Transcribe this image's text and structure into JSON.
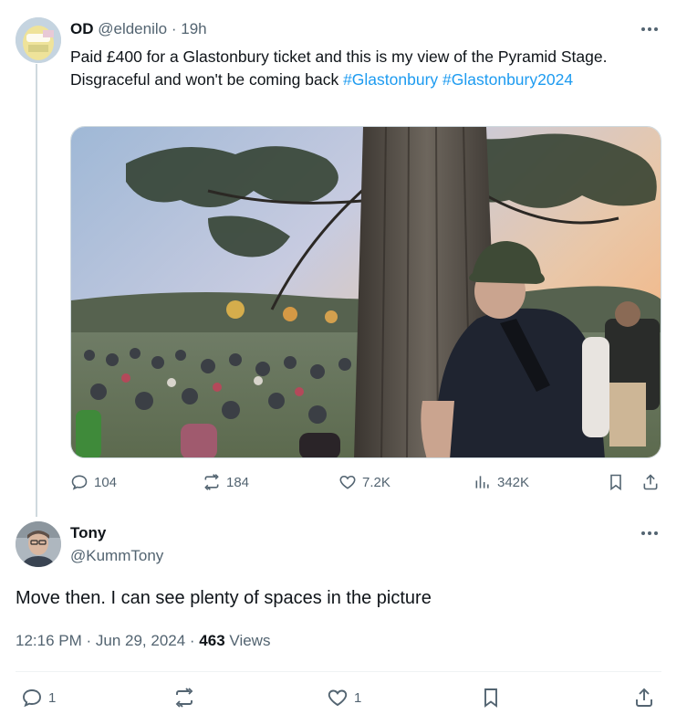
{
  "tweet1": {
    "author_name": "OD",
    "handle": "@eldenilo",
    "separator": "·",
    "time_ago": "19h",
    "text": "Paid £400 for a Glastonbury ticket and this is my view of the Pyramid Stage. Disgraceful and won't be coming back ",
    "hashtags": [
      "#Glastonbury",
      "#Glastonbury2024"
    ],
    "stats": {
      "replies": "104",
      "reposts": "184",
      "likes": "7.2K",
      "views": "342K"
    }
  },
  "tweet2": {
    "author_name": "Tony",
    "handle": "@KummTony",
    "text": "Move then. I can see plenty of spaces in the picture",
    "timestamp": "12:16 PM · Jun 29, 2024",
    "meta_separator": " · ",
    "view_count": "463",
    "views_label": "Views",
    "stats": {
      "replies": "1",
      "likes": "1"
    }
  },
  "icons": {
    "reply": "reply-icon",
    "repost": "repost-icon",
    "like": "heart-icon",
    "views": "views-icon",
    "bookmark": "bookmark-icon",
    "share": "share-icon",
    "more": "more-icon"
  },
  "colors": {
    "link": "#1d9bf0",
    "secondary_text": "#536471",
    "primary_text": "#0f1419",
    "thread_line": "#cfd9de"
  }
}
